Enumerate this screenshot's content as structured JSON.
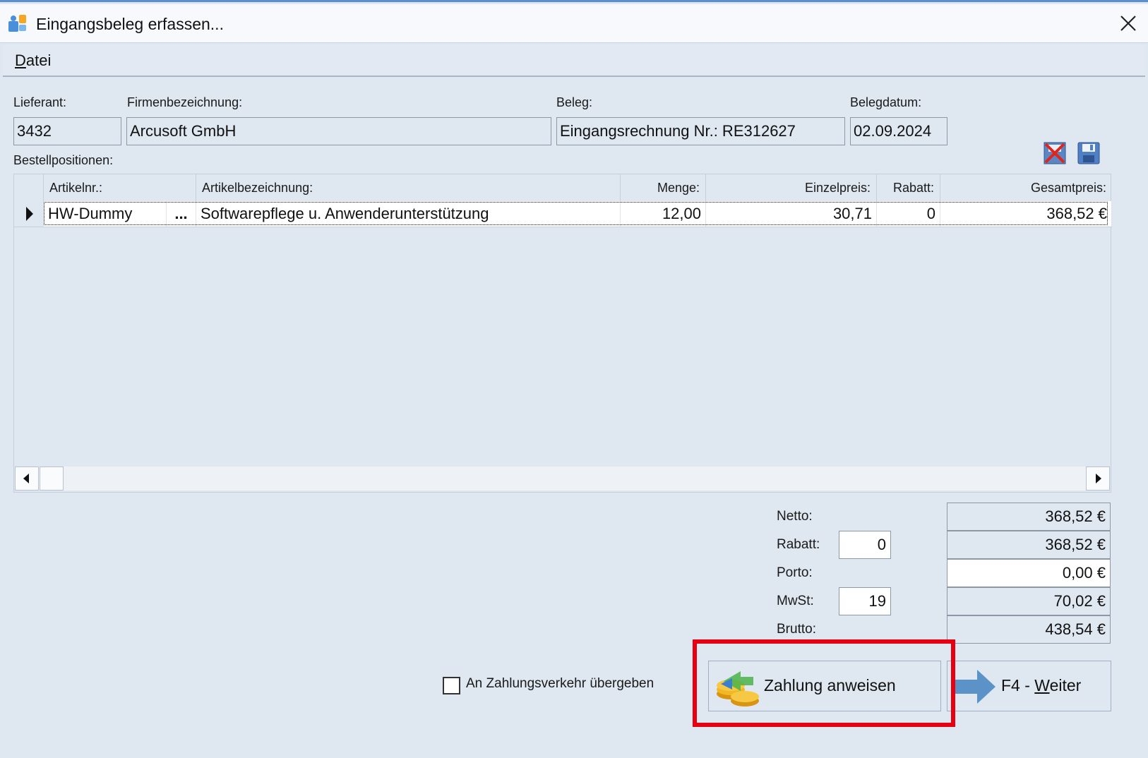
{
  "window": {
    "title": "Eingangsbeleg erfassen..."
  },
  "menu": {
    "datei_mnemonic": "D",
    "datei_rest": "atei"
  },
  "header": {
    "lieferant_label": "Lieferant:",
    "firma_label": "Firmenbezeichnung:",
    "beleg_label": "Beleg:",
    "belegdatum_label": "Belegdatum:",
    "lieferant_value": "3432",
    "firma_value": "Arcusoft GmbH",
    "beleg_value": "Eingangsrechnung Nr.: RE312627",
    "belegdatum_value": "02.09.2024",
    "positions_label": "Bestellpositionen:"
  },
  "icons": {
    "delete": "delete-x-icon",
    "save": "save-disk-icon",
    "app": "app-icon",
    "close": "close-icon"
  },
  "grid": {
    "columns": [
      "Artikelnr.:",
      "Artikelbezeichnung:",
      "Menge:",
      "Einzelpreis:",
      "Rabatt:",
      "Gesamtpreis:"
    ],
    "rows": [
      {
        "artikelnr": "HW-Dummy",
        "ellipsis": "...",
        "bezeichnung": "Softwarepflege  u. Anwenderunterstützung",
        "menge": "12,00",
        "einzelpreis": "30,71",
        "rabatt": "0",
        "gesamtpreis": "368,52 €"
      }
    ]
  },
  "totals": {
    "netto_label": "Netto:",
    "rabatt_label": "Rabatt:",
    "porto_label": "Porto:",
    "mwst_label": "MwSt:",
    "brutto_label": "Brutto:",
    "rabatt_input": "0",
    "mwst_input": "19",
    "netto": "368,52 €",
    "rabatt_value": "368,52 €",
    "porto": "0,00 €",
    "mwst_value": "70,02 €",
    "brutto": "438,54 €"
  },
  "footer": {
    "checkbox_label": "An Zahlungsverkehr übergeben",
    "checkbox_checked": false,
    "zahlung_button": "Zahlung anweisen",
    "weiter_prefix": "F4 - ",
    "weiter_mnemonic": "W",
    "weiter_rest": "eiter"
  },
  "colors": {
    "highlight": "#e60012",
    "background": "#dfe7f1",
    "accent": "#5b8fd3"
  }
}
